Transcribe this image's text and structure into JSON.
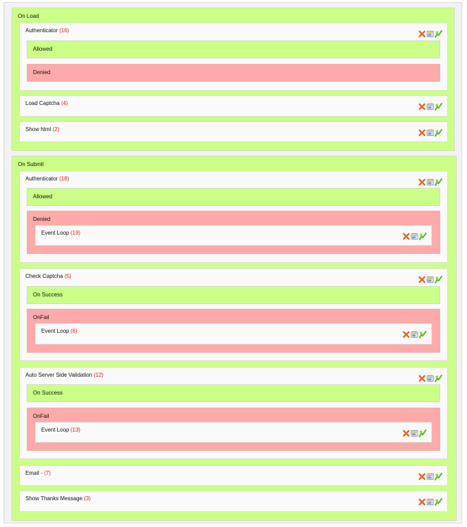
{
  "sections": [
    {
      "label": "On Load",
      "actions": [
        {
          "name": "Authenticator",
          "count": "(16)",
          "events": [
            {
              "label": "Allowed",
              "type": "success"
            },
            {
              "label": "Denied",
              "type": "fail"
            }
          ]
        },
        {
          "name": "Load Captcha",
          "count": "(4)"
        },
        {
          "name": "Show html",
          "count": "(2)"
        }
      ]
    },
    {
      "label": "On Submit",
      "actions": [
        {
          "name": "Authenticator",
          "count": "(18)",
          "events": [
            {
              "label": "Allowed",
              "type": "success"
            },
            {
              "label": "Denied",
              "type": "fail",
              "actions": [
                {
                  "name": "Event Loop",
                  "count": "(19)"
                }
              ]
            }
          ]
        },
        {
          "name": "Check Captcha",
          "count": "(5)",
          "events": [
            {
              "label": "On Success",
              "type": "success"
            },
            {
              "label": "OnFail",
              "type": "fail",
              "actions": [
                {
                  "name": "Event Loop",
                  "count": "(6)"
                }
              ]
            }
          ]
        },
        {
          "name": "Auto Server Side Validation",
          "count": "(12)",
          "events": [
            {
              "label": "On Success",
              "type": "success"
            },
            {
              "label": "OnFail",
              "type": "fail",
              "actions": [
                {
                  "name": "Event Loop",
                  "count": "(13)"
                }
              ]
            }
          ]
        },
        {
          "name": "Email -",
          "count": "(7)"
        },
        {
          "name": "Show Thanks Message",
          "count": "(3)"
        }
      ]
    }
  ],
  "icons": [
    "delete-icon",
    "edit-icon",
    "move-icon"
  ],
  "colors": {
    "success_bg": "#ccff88",
    "fail_bg": "#ffaaaa",
    "action_bg": "#fafafa",
    "count_text": "#cc2222",
    "delete_icon": "#e8601c",
    "move_icon": "#66bb22"
  }
}
